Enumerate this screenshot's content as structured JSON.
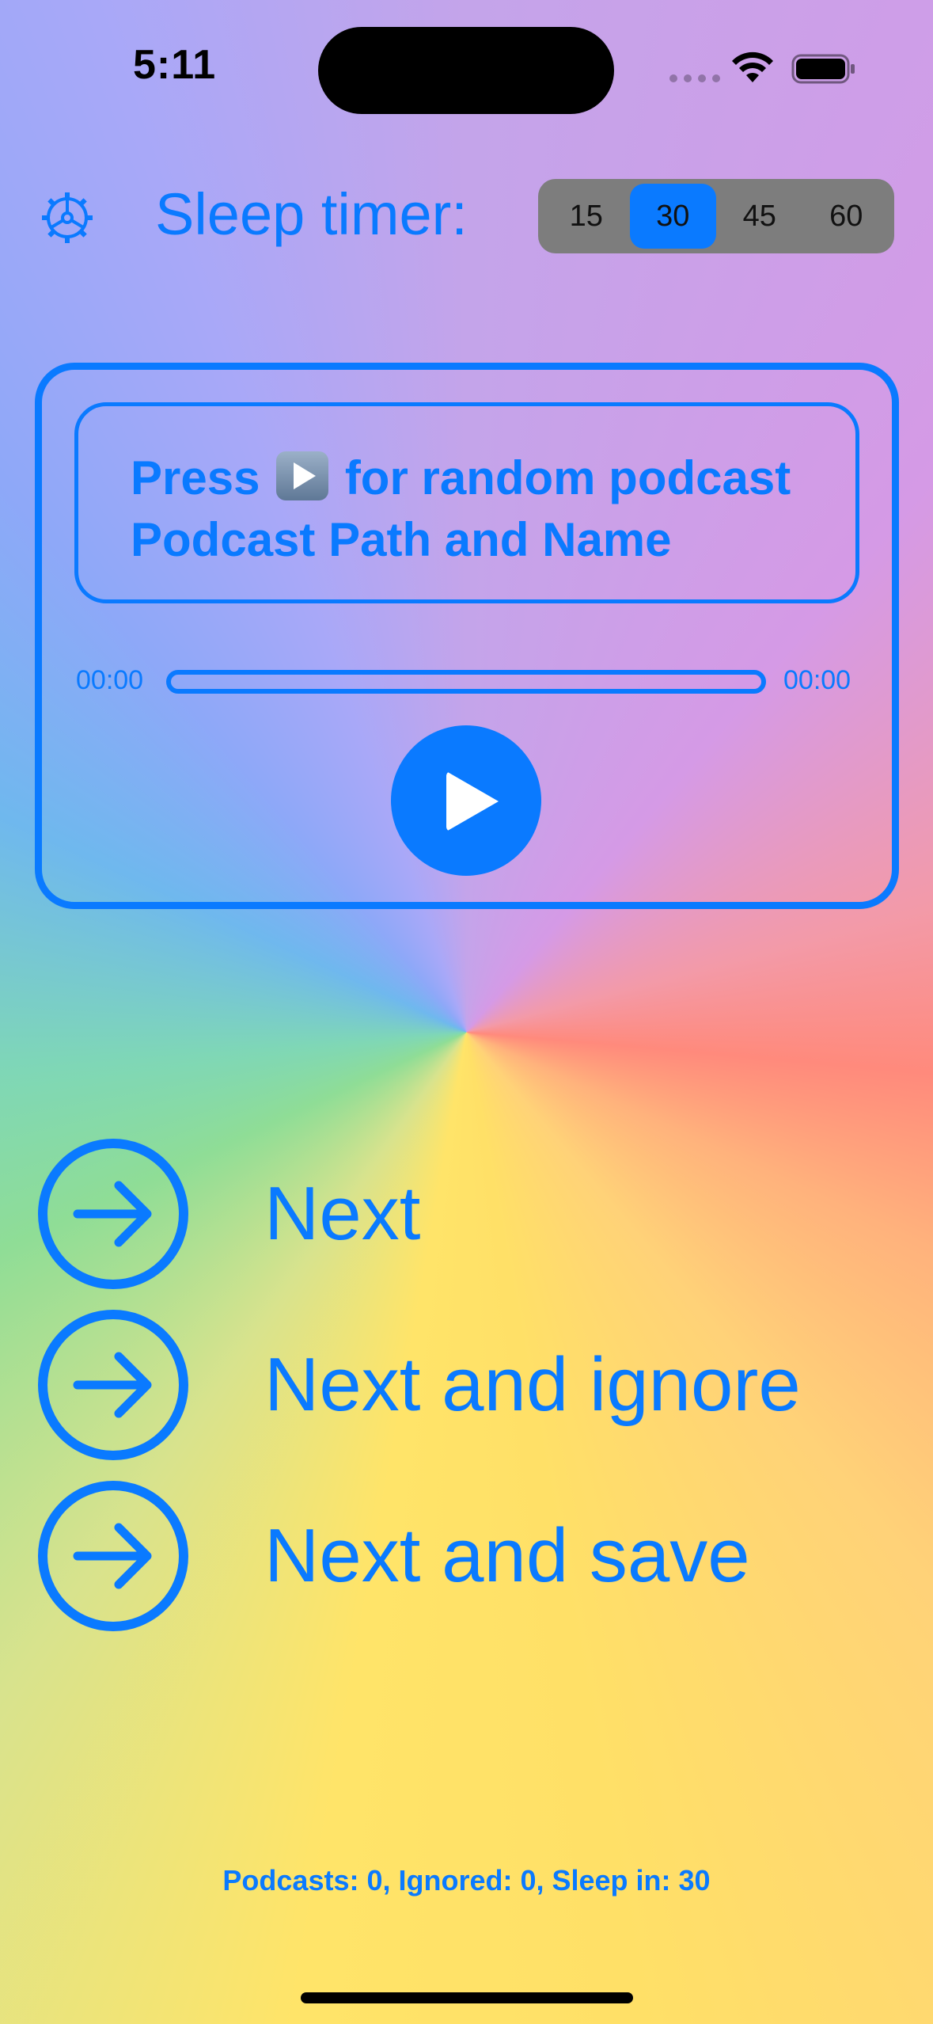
{
  "status_bar": {
    "time": "5:11"
  },
  "header": {
    "settings_icon": "gear-icon",
    "sleep_timer_label": "Sleep timer:",
    "sleep_options": [
      "15",
      "30",
      "45",
      "60"
    ],
    "selected_option": "30"
  },
  "player": {
    "line1_before": "Press",
    "line1_after": "for random podcast",
    "line2": "Podcast Path and Name",
    "elapsed": "00:00",
    "remaining": "00:00",
    "progress": 0,
    "play_icon": "play-icon"
  },
  "actions": {
    "next": "Next",
    "next_ignore": "Next and ignore",
    "next_save": "Next and save"
  },
  "footer": {
    "stats": "Podcasts: 0, Ignored: 0, Sleep in: 30"
  },
  "colors": {
    "accent": "#0a7aff",
    "segment_bg": "#7d7d7d"
  }
}
